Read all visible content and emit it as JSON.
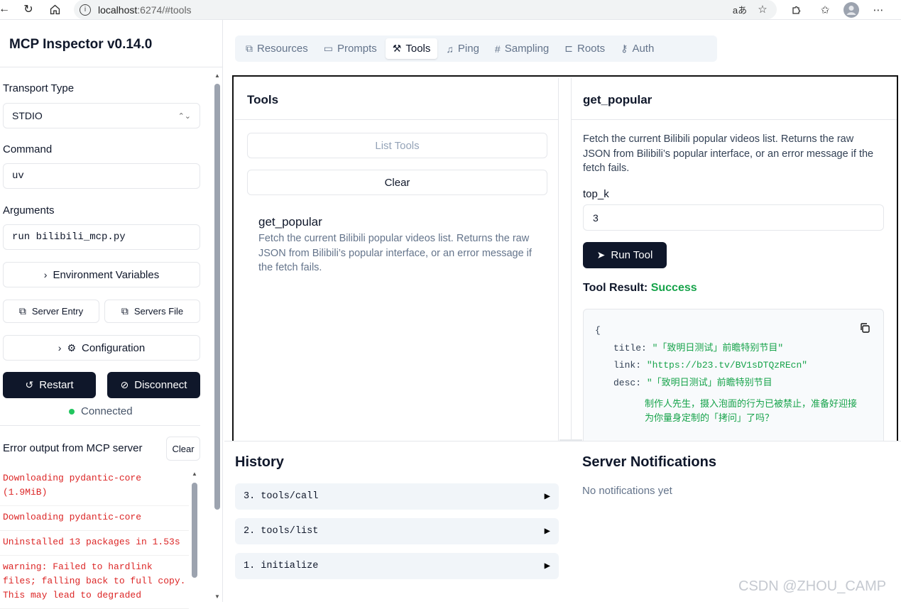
{
  "browser": {
    "url_host": "localhost",
    "url_rest": ":6274/#tools",
    "translate_label": "aあ"
  },
  "app": {
    "title": "MCP Inspector v0.14.0"
  },
  "sidebar": {
    "transport_label": "Transport Type",
    "transport_value": "STDIO",
    "command_label": "Command",
    "command_value": "uv",
    "arguments_label": "Arguments",
    "arguments_value": "run bilibili_mcp.py",
    "env_label": "Environment Variables",
    "server_entry_label": "Server Entry",
    "servers_file_label": "Servers File",
    "config_label": "Configuration",
    "restart_label": "Restart",
    "disconnect_label": "Disconnect",
    "status_text": "Connected",
    "status_color": "#22c55e",
    "error_title": "Error output from MCP server",
    "error_clear": "Clear",
    "errors": [
      "Downloading pydantic-core (1.9MiB)",
      "Downloading pydantic-core",
      "Uninstalled 13 packages in 1.53s",
      "warning: Failed to hardlink files; falling back to full copy. This may lead to degraded"
    ]
  },
  "tabs": [
    {
      "label": "Resources",
      "icon": "copy-icon"
    },
    {
      "label": "Prompts",
      "icon": "message-icon"
    },
    {
      "label": "Tools",
      "icon": "hammer-icon"
    },
    {
      "label": "Ping",
      "icon": "bell-icon"
    },
    {
      "label": "Sampling",
      "icon": "hash-icon"
    },
    {
      "label": "Roots",
      "icon": "folder-tree-icon"
    },
    {
      "label": "Auth",
      "icon": "key-icon"
    }
  ],
  "tools_pane": {
    "title": "Tools",
    "list_button": "List Tools",
    "clear_button": "Clear",
    "tool": {
      "name": "get_popular",
      "description": "Fetch the current Bilibili popular videos list. Returns the raw JSON from Bilibili’s popular interface, or an error message if the fetch fails."
    }
  },
  "detail": {
    "title": "get_popular",
    "description": "Fetch the current Bilibili popular videos list. Returns the raw JSON from Bilibili’s popular interface, or an error message if the fetch fails.",
    "param_label": "top_k",
    "param_value": "3",
    "run_button": "Run Tool",
    "result_label": "Tool Result:",
    "result_status": "Success",
    "json_open": "{",
    "json": {
      "title_key": "title:",
      "title_val": "\"「致明日测试」前瞻特别节目\"",
      "link_key": "link:",
      "link_val": "\"https://b23.tv/BV1sDTQzREcn\"",
      "desc_key": "desc:",
      "desc_val": "\"「致明日测试」前瞻特别节目",
      "desc_line2": "制作人先生，摄入泡面的行为已被禁止，准备好迎接为你量身定制的「拷问」了吗？"
    }
  },
  "history": {
    "title": "History",
    "items": [
      "3. tools/call",
      "2. tools/list",
      "1. initialize"
    ]
  },
  "notifications": {
    "title": "Server Notifications",
    "empty": "No notifications yet"
  },
  "watermark": "CSDN @ZHOU_CAMP"
}
